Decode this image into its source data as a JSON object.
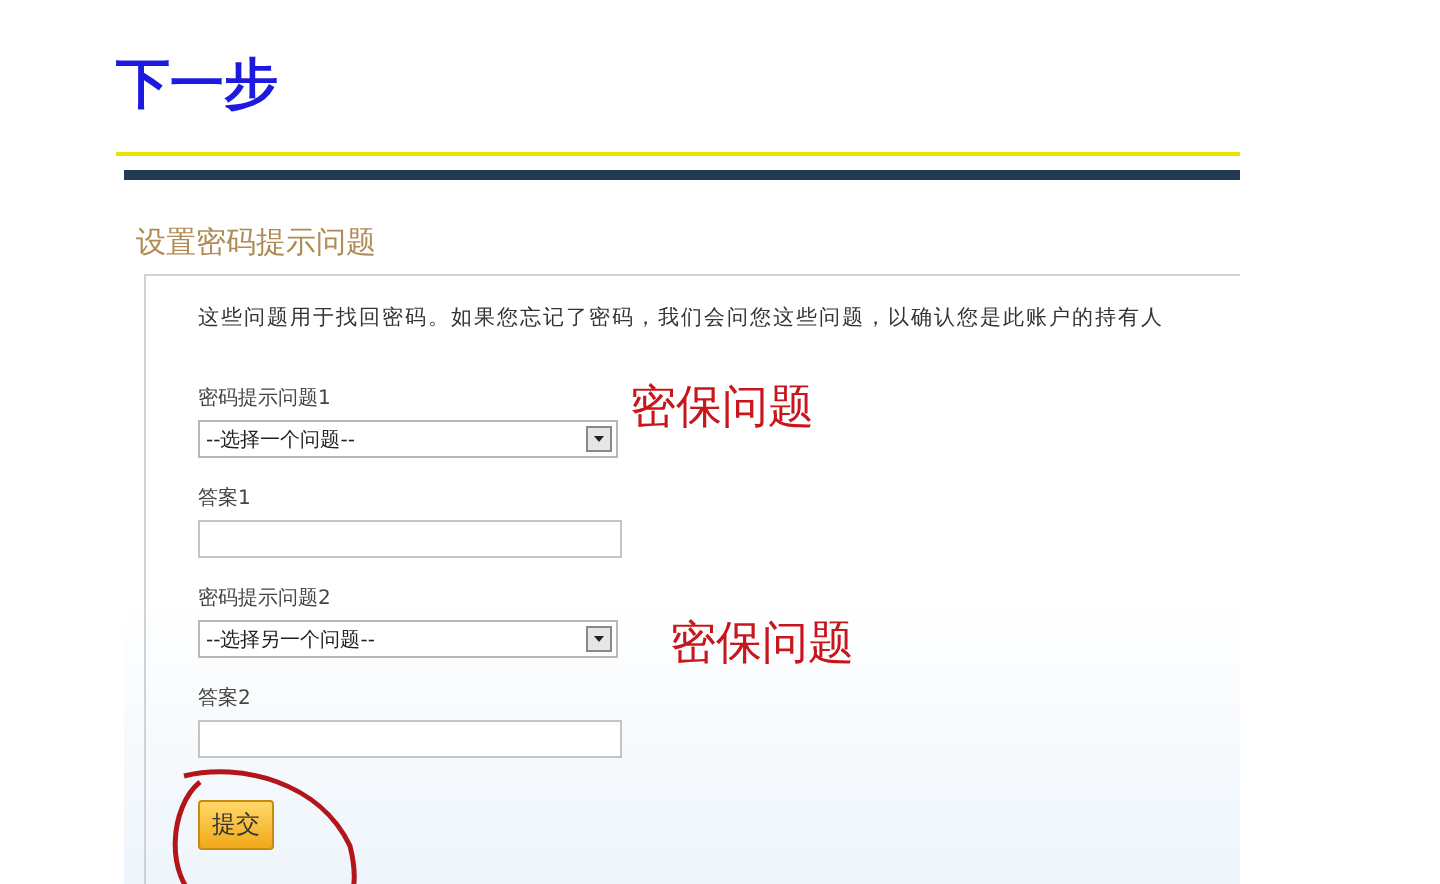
{
  "heading": "下一步",
  "form": {
    "title": "设置密码提示问题",
    "description": "这些问题用于找回密码。如果您忘记了密码，我们会问您这些问题，以确认您是此账户的持有人",
    "fields": [
      {
        "kind": "select",
        "label": "密码提示问题1",
        "value": "--选择一个问题--"
      },
      {
        "kind": "text",
        "label": "答案1"
      },
      {
        "kind": "select",
        "label": "密码提示问题2",
        "value": "--选择另一个问题--"
      },
      {
        "kind": "text",
        "label": "答案2"
      }
    ],
    "submit": "提交"
  },
  "annotations": [
    {
      "kind": "note",
      "text": "密保问题"
    },
    {
      "kind": "note",
      "text": "密保问题"
    },
    {
      "kind": "circle"
    }
  ]
}
